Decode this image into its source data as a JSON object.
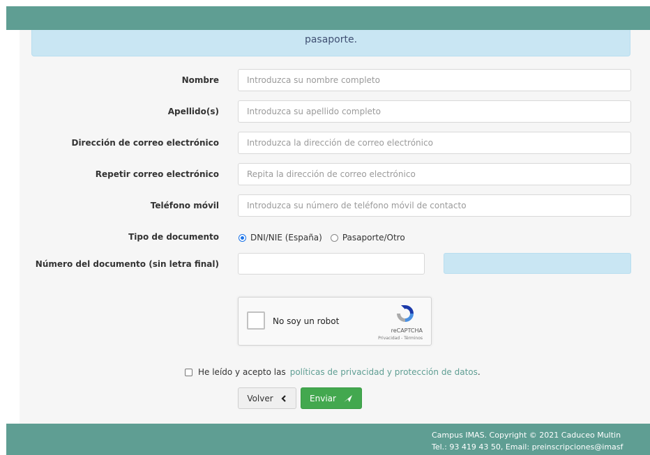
{
  "info_text": "pasaporte.",
  "form": {
    "fields": [
      {
        "label": "Nombre",
        "placeholder": "Introduzca su nombre completo"
      },
      {
        "label": "Apellido(s)",
        "placeholder": "Introduzca su apellido completo"
      },
      {
        "label": "Dirección de correo electrónico",
        "placeholder": "Introduzca la dirección de correo electrónico"
      },
      {
        "label": "Repetir correo electrónico",
        "placeholder": "Repita la dirección de correo electrónico"
      },
      {
        "label": "Teléfono móvil",
        "placeholder": "Introduzca su número de teléfono móvil de contacto"
      }
    ],
    "doc_type": {
      "label": "Tipo de documento",
      "options": [
        "DNI/NIE (España)",
        "Pasaporte/Otro"
      ],
      "selected": "DNI/NIE (España)"
    },
    "doc_number": {
      "label": "Número del documento (sin letra final)",
      "value": ""
    }
  },
  "captcha": {
    "text": "No soy un robot",
    "brand": "reCAPTCHA",
    "links": "Privacidad - Términos"
  },
  "consent": {
    "prefix": "He leído y acepto las",
    "link": "políticas de privacidad y protección de datos",
    "suffix": "."
  },
  "buttons": {
    "back": "Volver",
    "send": "Enviar"
  },
  "footer": {
    "line1": "Campus IMAS. Copyright © 2021 Caduceo Multin",
    "line2": "Tel.: 93 419 43 50, Email: preinscripciones@imasf"
  },
  "colors": {
    "header": "#5f9e93",
    "info_box": "#c9e6f3",
    "send_button": "#43a84f",
    "link": "#5f9e93"
  },
  "icons": {
    "back": "chevron-left-icon",
    "send": "paper-plane-icon",
    "captcha": "recaptcha-logo-icon"
  }
}
